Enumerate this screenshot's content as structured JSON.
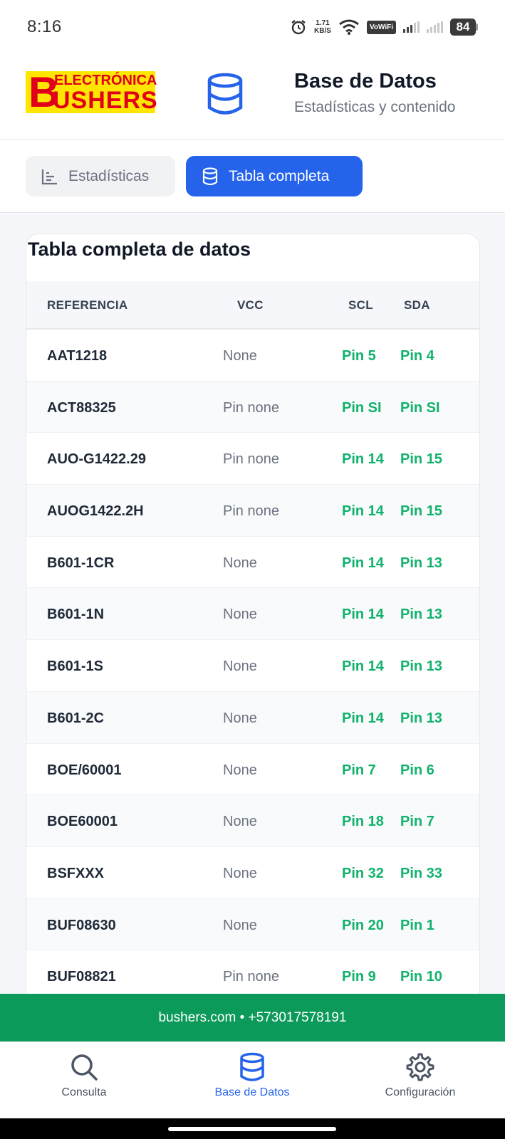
{
  "status_bar": {
    "time": "8:16",
    "net_speed_value": "1.71",
    "net_speed_unit": "KB/S",
    "vowifi": "VoWiFi",
    "battery": "84"
  },
  "header": {
    "logo_top": "ELECTRÓNICA",
    "logo_b": "B",
    "logo_bottom": "USHERS",
    "title": "Base de Datos",
    "subtitle": "Estadísticas y contenido"
  },
  "tabs": [
    {
      "label": "Estadísticas",
      "active": false
    },
    {
      "label": "Tabla completa",
      "active": true
    }
  ],
  "table": {
    "title": "Tabla completa de datos",
    "columns": [
      "REFERENCIA",
      "VCC",
      "SCL",
      "SDA"
    ],
    "rows": [
      {
        "ref": "AAT1218",
        "vcc": "None",
        "scl": "Pin 5",
        "sda": "Pin 4"
      },
      {
        "ref": "ACT88325",
        "vcc": "Pin none",
        "scl": "Pin SI",
        "sda": "Pin SI"
      },
      {
        "ref": "AUO-G1422.29",
        "vcc": "Pin none",
        "scl": "Pin 14",
        "sda": "Pin 15"
      },
      {
        "ref": "AUOG1422.2H",
        "vcc": "Pin none",
        "scl": "Pin 14",
        "sda": "Pin 15"
      },
      {
        "ref": "B601-1CR",
        "vcc": "None",
        "scl": "Pin 14",
        "sda": "Pin 13"
      },
      {
        "ref": "B601-1N",
        "vcc": "None",
        "scl": "Pin 14",
        "sda": "Pin 13"
      },
      {
        "ref": "B601-1S",
        "vcc": "None",
        "scl": "Pin 14",
        "sda": "Pin 13"
      },
      {
        "ref": "B601-2C",
        "vcc": "None",
        "scl": "Pin 14",
        "sda": "Pin 13"
      },
      {
        "ref": "BOE/60001",
        "vcc": "None",
        "scl": "Pin 7",
        "sda": "Pin 6"
      },
      {
        "ref": "BOE60001",
        "vcc": "None",
        "scl": "Pin 18",
        "sda": "Pin 7"
      },
      {
        "ref": "BSFXXX",
        "vcc": "None",
        "scl": "Pin 32",
        "sda": "Pin 33"
      },
      {
        "ref": "BUF08630",
        "vcc": "None",
        "scl": "Pin 20",
        "sda": "Pin 1"
      },
      {
        "ref": "BUF08821",
        "vcc": "Pin none",
        "scl": "Pin 9",
        "sda": "Pin 10"
      }
    ]
  },
  "banner": {
    "text": "bushers.com • +573017578191"
  },
  "bottom_nav": [
    {
      "label": "Consulta",
      "icon": "search-icon",
      "active": false
    },
    {
      "label": "Base de Datos",
      "icon": "database-icon",
      "active": true
    },
    {
      "label": "Configuración",
      "icon": "gear-icon",
      "active": false
    }
  ],
  "colors": {
    "primary": "#2563eb",
    "pin_green": "#10b26c",
    "banner_green": "#0c9a5a",
    "logo_yellow": "#ffe600",
    "logo_red": "#e1001a"
  }
}
